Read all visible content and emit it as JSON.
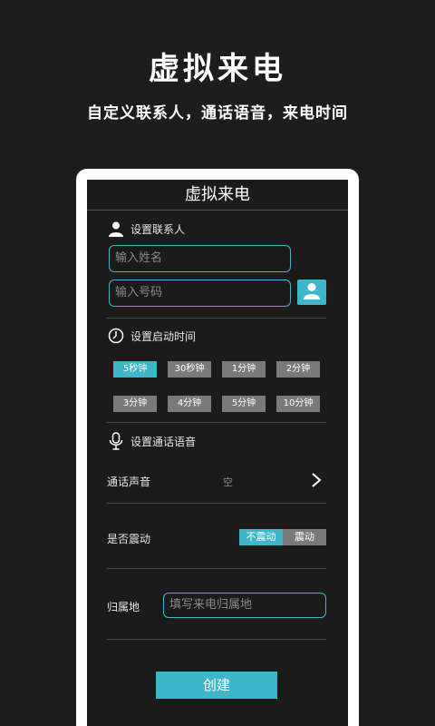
{
  "hero": {
    "title": "虚拟来电",
    "subtitle": "自定义联系人，通话语音，来电时间"
  },
  "app": {
    "header_title": "虚拟来电",
    "contact": {
      "heading": "设置联系人",
      "name_placeholder": "输入姓名",
      "number_placeholder": "输入号码"
    },
    "start_time": {
      "heading": "设置启动时间",
      "options": [
        "5秒钟",
        "30秒钟",
        "1分钟",
        "2分钟",
        "3分钟",
        "4分钟",
        "5分钟",
        "10分钟"
      ],
      "selected": "5秒钟"
    },
    "voice": {
      "heading": "设置通话语音",
      "sound_label": "通话声音",
      "sound_value": "空"
    },
    "vibrate": {
      "label": "是否震动",
      "options": [
        "不震动",
        "震动"
      ],
      "selected": "不震动"
    },
    "location": {
      "label": "归属地",
      "placeholder": "填写来电归属地"
    },
    "create_label": "创建"
  },
  "colors": {
    "accent": "#3fb6c8",
    "background": "#1b1b1b",
    "inactive_button": "#7a7a7a"
  }
}
